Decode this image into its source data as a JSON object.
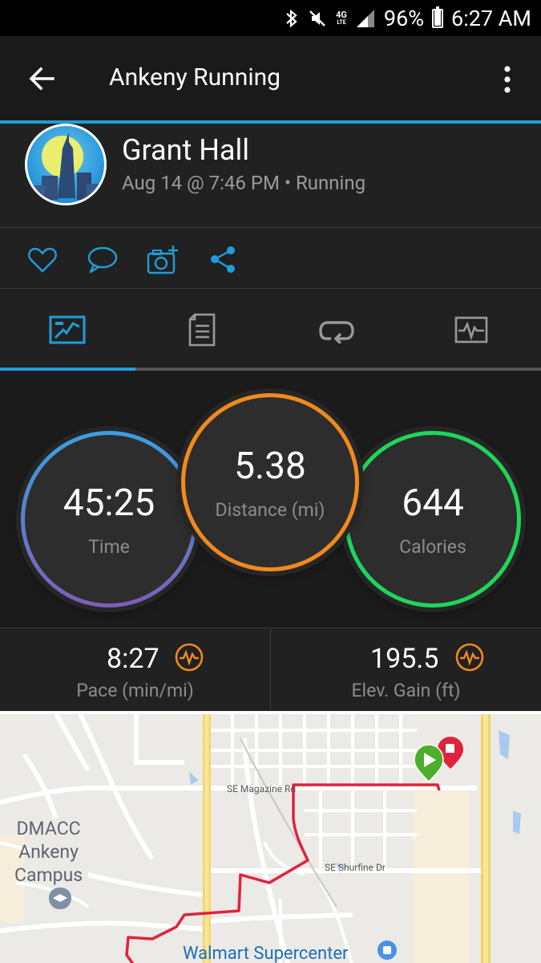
{
  "status_bar": {
    "battery": "96%",
    "battery_level": 0.96,
    "time": "6:27 AM",
    "network": "4G",
    "network_sub": "LTE"
  },
  "app_bar": {
    "title": "Ankeny Running"
  },
  "activity": {
    "user_name": "Grant Hall",
    "meta": "Aug 14 @ 7:46 PM • Running"
  },
  "actions": [
    "heart-icon",
    "comment-icon",
    "camera-add-icon",
    "share-icon"
  ],
  "tabs": [
    {
      "icon": "map-stats-icon",
      "selected": true
    },
    {
      "icon": "details-list-icon",
      "selected": false
    },
    {
      "icon": "laps-icon",
      "selected": false
    },
    {
      "icon": "charts-icon",
      "selected": false
    }
  ],
  "stats": {
    "time": {
      "value": "45:25",
      "label": "Time"
    },
    "distance": {
      "value": "5.38",
      "label": "Distance (mi)"
    },
    "calories": {
      "value": "644",
      "label": "Calories"
    }
  },
  "metrics": {
    "pace": {
      "value": "8:27",
      "label": "Pace (min/mi)"
    },
    "elevation": {
      "value": "195.5",
      "label": "Elev. Gain (ft)"
    }
  },
  "map": {
    "labels": {
      "magazine": "SE Magazine Rd",
      "shurfine": "SE Shurfine Dr",
      "campus": "DMACC\nAnkeny\nCampus",
      "walmart": "Walmart Supercenter"
    }
  },
  "colors": {
    "accent_blue": "#1e9ed9",
    "distance_orange": "#f08a1f",
    "calories_green": "#1fd65a",
    "route_red": "#e0223c",
    "start_green": "#4cae2c"
  }
}
